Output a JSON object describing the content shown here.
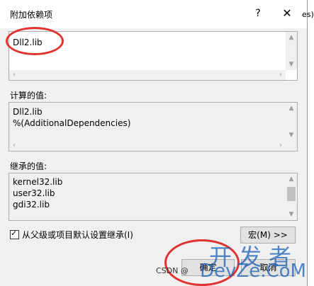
{
  "dialog": {
    "title": "附加依赖项",
    "help_glyph": "?",
    "close_glyph": "✕",
    "edge_text": "es)"
  },
  "input": {
    "lines": [
      "Dll2.lib"
    ]
  },
  "computed": {
    "label": "计算的值:",
    "lines": [
      "Dll2.lib",
      "%(AdditionalDependencies)"
    ]
  },
  "inherited": {
    "label": "继承的值:",
    "lines": [
      "kernel32.lib",
      "user32.lib",
      "gdi32.lib"
    ]
  },
  "inherit_checkbox": {
    "label": "从父级或项目默认设置继承(I)",
    "checked": true
  },
  "buttons": {
    "macros": "宏(M) >>",
    "ok": "确定",
    "cancel": "取消"
  },
  "watermark": {
    "cn": "开发者",
    "en": "DevZe.CoM",
    "csdn": "CSDN @"
  },
  "annotation_color": "#e0332f"
}
